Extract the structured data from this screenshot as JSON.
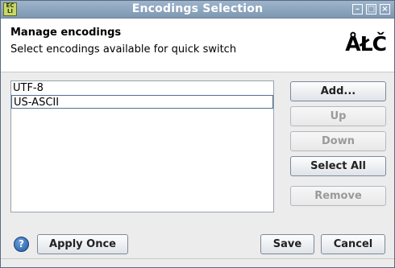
{
  "window": {
    "title": "Encodings Selection",
    "icon_name": "app-icon",
    "icon_text": "ECL\nIPS"
  },
  "header": {
    "title": "Manage encodings",
    "subtitle": "Select encodings available for quick switch",
    "logo_text": "ÅŁČ"
  },
  "encodings": {
    "items": [
      {
        "label": "UTF-8",
        "selected": false
      },
      {
        "label": "US-ASCII",
        "selected": true
      }
    ]
  },
  "buttons": {
    "add": "Add...",
    "up": "Up",
    "down": "Down",
    "select_all": "Select All",
    "remove": "Remove",
    "apply_once": "Apply Once",
    "save": "Save",
    "cancel": "Cancel",
    "help": "?"
  },
  "colors": {
    "titlebar": "#8aa3bd",
    "selection_border": "#4f6f97"
  }
}
